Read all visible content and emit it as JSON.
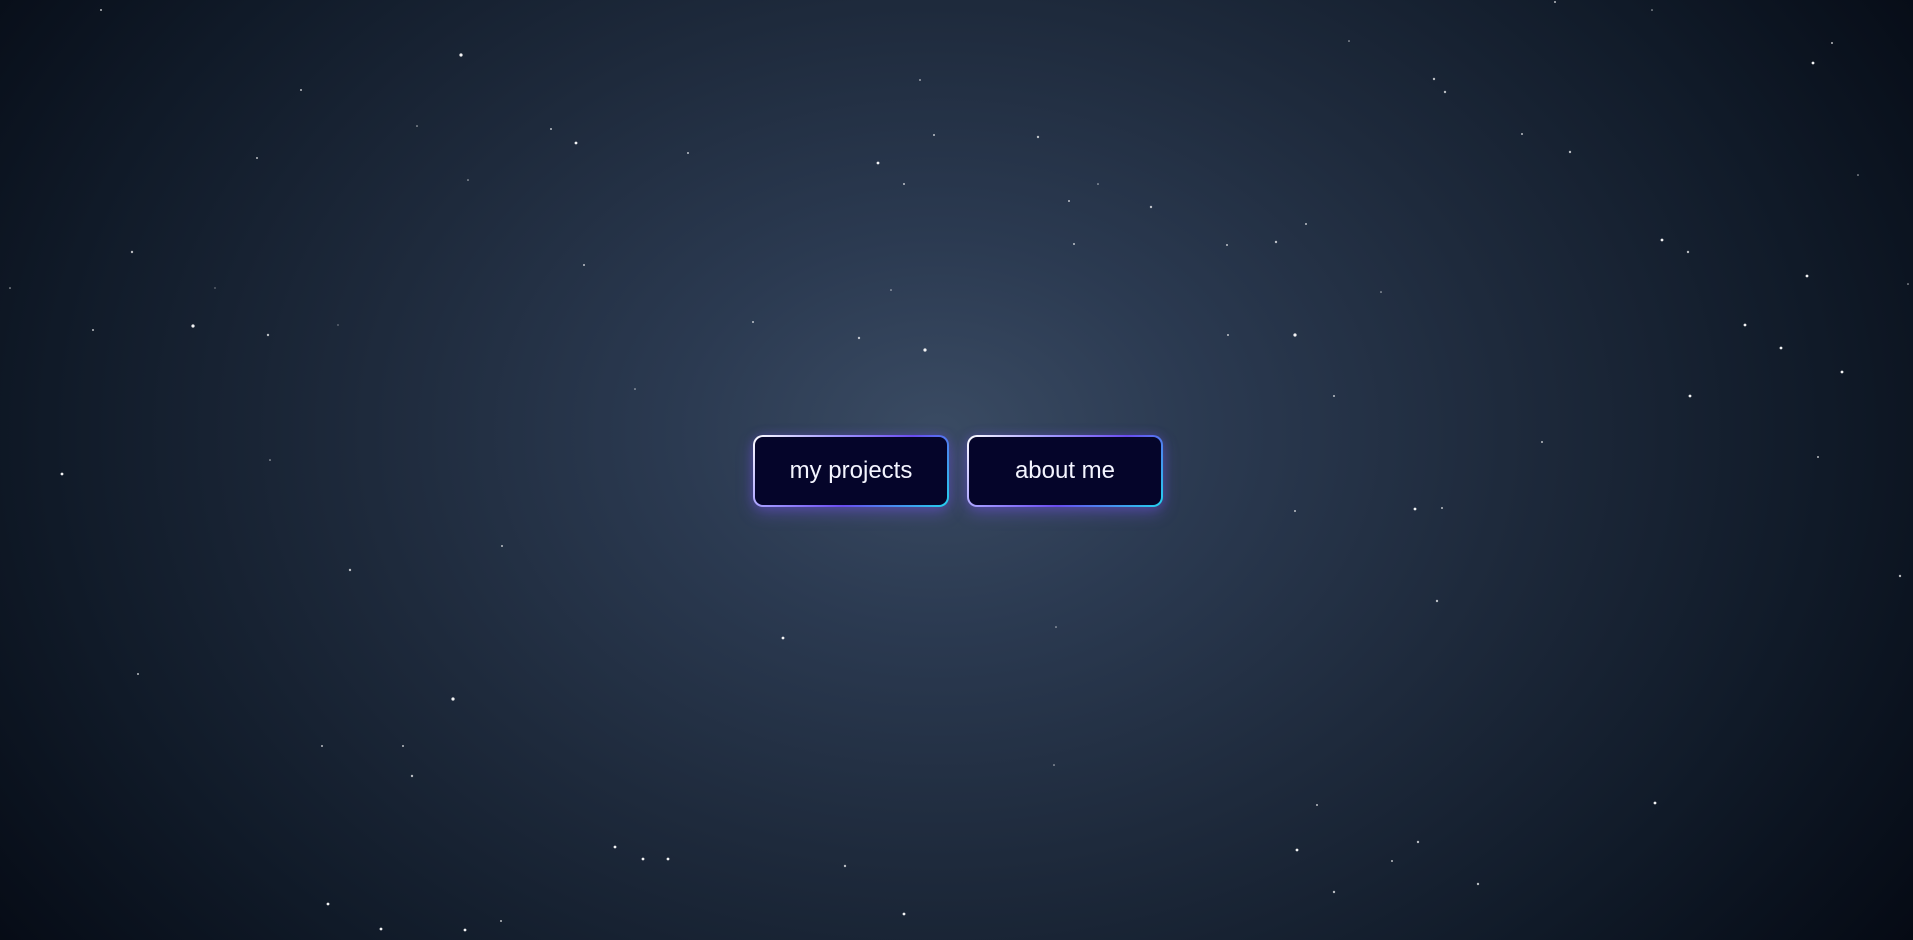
{
  "nav": {
    "projects_label": "my projects",
    "about_label": "about me"
  },
  "colors": {
    "button_fill": "#05052a",
    "button_border_start": "#ffffff",
    "button_border_mid": "#6a4cf0",
    "button_border_end": "#22d3ee",
    "button_text": "#f4f5ff",
    "background_center": "#3a4b63",
    "background_edge": "#050a14",
    "star": "#ffffff"
  }
}
